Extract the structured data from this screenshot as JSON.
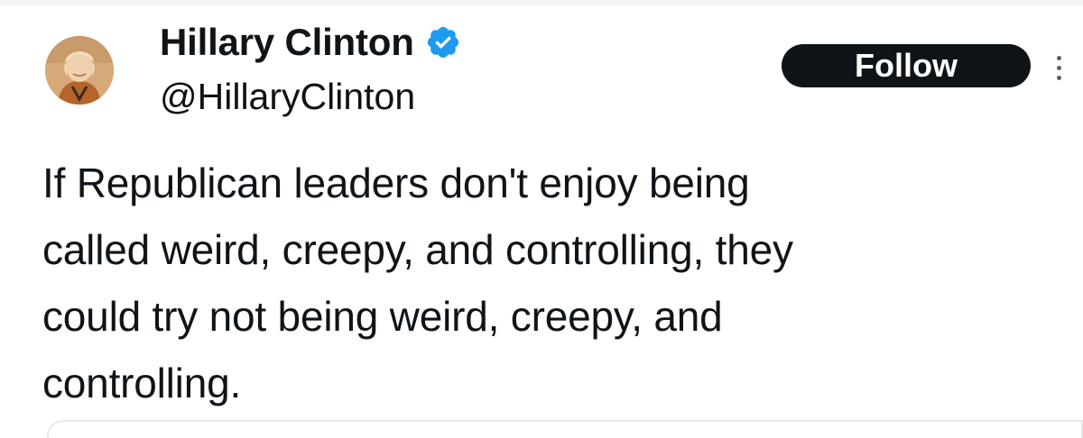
{
  "author": {
    "display_name": "Hillary Clinton",
    "handle": "@HillaryClinton",
    "verified": true
  },
  "actions": {
    "follow_label": "Follow"
  },
  "tweet": {
    "lines": [
      "If Republican leaders don't enjoy being",
      "called weird, creepy, and controlling, they",
      "could try not being weird, creepy, and",
      "controlling."
    ]
  },
  "icons": {
    "verified": "verified-badge-icon",
    "more": "more-options-icon"
  },
  "colors": {
    "text": "#0f1419",
    "verified_blue": "#1d9bf0",
    "follow_bg": "#0f1419",
    "follow_text": "#ffffff",
    "muted": "#536471"
  }
}
